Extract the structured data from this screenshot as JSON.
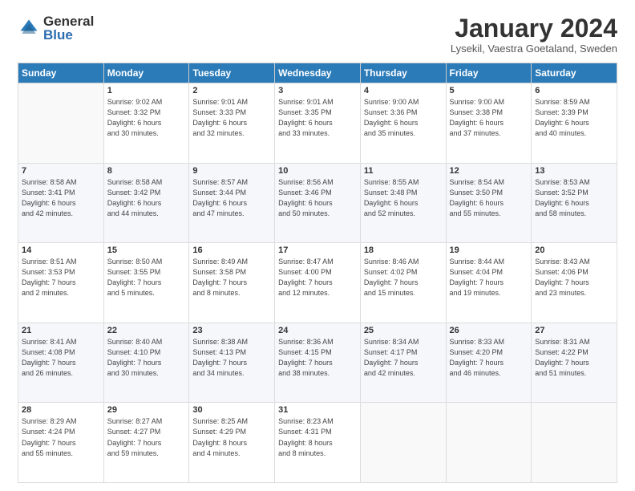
{
  "logo": {
    "general": "General",
    "blue": "Blue"
  },
  "title": "January 2024",
  "location": "Lysekil, Vaestra Goetaland, Sweden",
  "headers": [
    "Sunday",
    "Monday",
    "Tuesday",
    "Wednesday",
    "Thursday",
    "Friday",
    "Saturday"
  ],
  "weeks": [
    [
      {
        "day": "",
        "info": ""
      },
      {
        "day": "1",
        "info": "Sunrise: 9:02 AM\nSunset: 3:32 PM\nDaylight: 6 hours\nand 30 minutes."
      },
      {
        "day": "2",
        "info": "Sunrise: 9:01 AM\nSunset: 3:33 PM\nDaylight: 6 hours\nand 32 minutes."
      },
      {
        "day": "3",
        "info": "Sunrise: 9:01 AM\nSunset: 3:35 PM\nDaylight: 6 hours\nand 33 minutes."
      },
      {
        "day": "4",
        "info": "Sunrise: 9:00 AM\nSunset: 3:36 PM\nDaylight: 6 hours\nand 35 minutes."
      },
      {
        "day": "5",
        "info": "Sunrise: 9:00 AM\nSunset: 3:38 PM\nDaylight: 6 hours\nand 37 minutes."
      },
      {
        "day": "6",
        "info": "Sunrise: 8:59 AM\nSunset: 3:39 PM\nDaylight: 6 hours\nand 40 minutes."
      }
    ],
    [
      {
        "day": "7",
        "info": "Sunrise: 8:58 AM\nSunset: 3:41 PM\nDaylight: 6 hours\nand 42 minutes."
      },
      {
        "day": "8",
        "info": "Sunrise: 8:58 AM\nSunset: 3:42 PM\nDaylight: 6 hours\nand 44 minutes."
      },
      {
        "day": "9",
        "info": "Sunrise: 8:57 AM\nSunset: 3:44 PM\nDaylight: 6 hours\nand 47 minutes."
      },
      {
        "day": "10",
        "info": "Sunrise: 8:56 AM\nSunset: 3:46 PM\nDaylight: 6 hours\nand 50 minutes."
      },
      {
        "day": "11",
        "info": "Sunrise: 8:55 AM\nSunset: 3:48 PM\nDaylight: 6 hours\nand 52 minutes."
      },
      {
        "day": "12",
        "info": "Sunrise: 8:54 AM\nSunset: 3:50 PM\nDaylight: 6 hours\nand 55 minutes."
      },
      {
        "day": "13",
        "info": "Sunrise: 8:53 AM\nSunset: 3:52 PM\nDaylight: 6 hours\nand 58 minutes."
      }
    ],
    [
      {
        "day": "14",
        "info": "Sunrise: 8:51 AM\nSunset: 3:53 PM\nDaylight: 7 hours\nand 2 minutes."
      },
      {
        "day": "15",
        "info": "Sunrise: 8:50 AM\nSunset: 3:55 PM\nDaylight: 7 hours\nand 5 minutes."
      },
      {
        "day": "16",
        "info": "Sunrise: 8:49 AM\nSunset: 3:58 PM\nDaylight: 7 hours\nand 8 minutes."
      },
      {
        "day": "17",
        "info": "Sunrise: 8:47 AM\nSunset: 4:00 PM\nDaylight: 7 hours\nand 12 minutes."
      },
      {
        "day": "18",
        "info": "Sunrise: 8:46 AM\nSunset: 4:02 PM\nDaylight: 7 hours\nand 15 minutes."
      },
      {
        "day": "19",
        "info": "Sunrise: 8:44 AM\nSunset: 4:04 PM\nDaylight: 7 hours\nand 19 minutes."
      },
      {
        "day": "20",
        "info": "Sunrise: 8:43 AM\nSunset: 4:06 PM\nDaylight: 7 hours\nand 23 minutes."
      }
    ],
    [
      {
        "day": "21",
        "info": "Sunrise: 8:41 AM\nSunset: 4:08 PM\nDaylight: 7 hours\nand 26 minutes."
      },
      {
        "day": "22",
        "info": "Sunrise: 8:40 AM\nSunset: 4:10 PM\nDaylight: 7 hours\nand 30 minutes."
      },
      {
        "day": "23",
        "info": "Sunrise: 8:38 AM\nSunset: 4:13 PM\nDaylight: 7 hours\nand 34 minutes."
      },
      {
        "day": "24",
        "info": "Sunrise: 8:36 AM\nSunset: 4:15 PM\nDaylight: 7 hours\nand 38 minutes."
      },
      {
        "day": "25",
        "info": "Sunrise: 8:34 AM\nSunset: 4:17 PM\nDaylight: 7 hours\nand 42 minutes."
      },
      {
        "day": "26",
        "info": "Sunrise: 8:33 AM\nSunset: 4:20 PM\nDaylight: 7 hours\nand 46 minutes."
      },
      {
        "day": "27",
        "info": "Sunrise: 8:31 AM\nSunset: 4:22 PM\nDaylight: 7 hours\nand 51 minutes."
      }
    ],
    [
      {
        "day": "28",
        "info": "Sunrise: 8:29 AM\nSunset: 4:24 PM\nDaylight: 7 hours\nand 55 minutes."
      },
      {
        "day": "29",
        "info": "Sunrise: 8:27 AM\nSunset: 4:27 PM\nDaylight: 7 hours\nand 59 minutes."
      },
      {
        "day": "30",
        "info": "Sunrise: 8:25 AM\nSunset: 4:29 PM\nDaylight: 8 hours\nand 4 minutes."
      },
      {
        "day": "31",
        "info": "Sunrise: 8:23 AM\nSunset: 4:31 PM\nDaylight: 8 hours\nand 8 minutes."
      },
      {
        "day": "",
        "info": ""
      },
      {
        "day": "",
        "info": ""
      },
      {
        "day": "",
        "info": ""
      }
    ]
  ]
}
